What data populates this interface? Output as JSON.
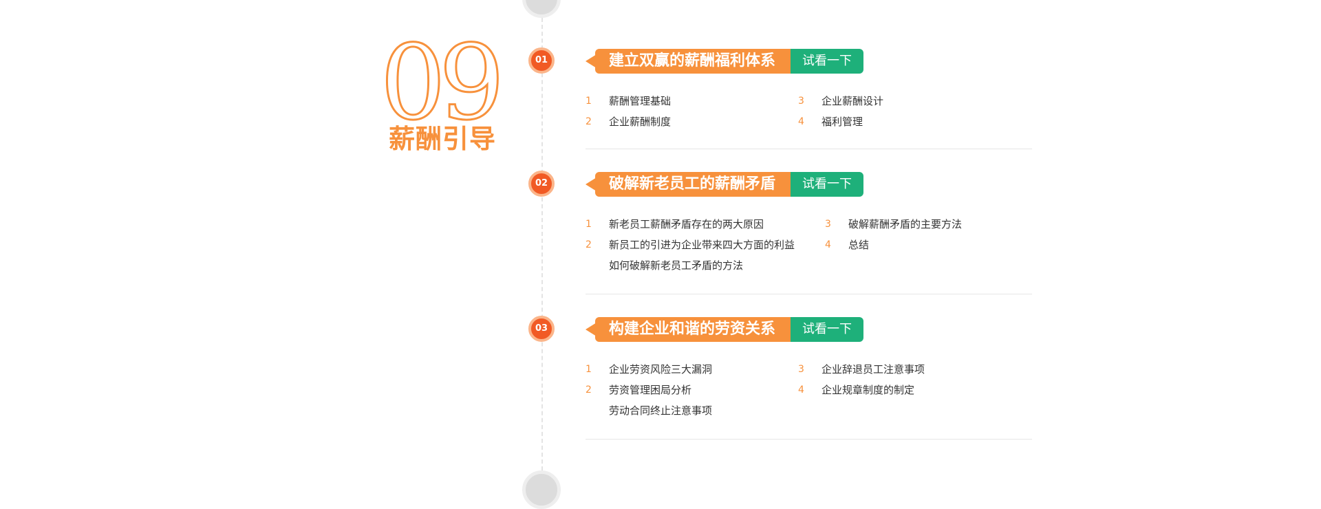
{
  "chapter": {
    "number": "09",
    "title": "薪酬引导"
  },
  "sections": [
    {
      "step": "01",
      "title": "建立双赢的薪酬福利体系",
      "button": "试看一下",
      "items": [
        {
          "num": "1",
          "text": "薪酬管理基础"
        },
        {
          "num": "2",
          "text": "企业薪酬制度"
        },
        {
          "num": "3",
          "text": "企业薪酬设计"
        },
        {
          "num": "4",
          "text": "福利管理"
        }
      ]
    },
    {
      "step": "02",
      "title": "破解新老员工的薪酬矛盾",
      "button": "试看一下",
      "items": [
        {
          "num": "1",
          "text": "新老员工薪酬矛盾存在的两大原因"
        },
        {
          "num": "2",
          "text": "新员工的引进为企业带来四大方面的利益"
        },
        {
          "num": "",
          "text": "如何破解新老员工矛盾的方法"
        },
        {
          "num": "3",
          "text": "破解薪酬矛盾的主要方法"
        },
        {
          "num": "4",
          "text": "总结"
        }
      ]
    },
    {
      "step": "03",
      "title": "构建企业和谐的劳资关系",
      "button": "试看一下",
      "items": [
        {
          "num": "1",
          "text": "企业劳资风险三大漏洞"
        },
        {
          "num": "2",
          "text": "劳资管理困局分析"
        },
        {
          "num": "",
          "text": "劳动合同终止注意事项"
        },
        {
          "num": "3",
          "text": "企业辞退员工注意事项"
        },
        {
          "num": "4",
          "text": "企业规章制度的制定"
        }
      ]
    }
  ],
  "colors": {
    "accent_orange": "#f7913c",
    "dot_red": "#f15a24",
    "button_green": "#1eb07a",
    "text": "#333333",
    "divider": "#e6e6e6"
  },
  "icons": {
    "banner_pointer": "triangle-left",
    "timeline_end_caps": "circle"
  }
}
